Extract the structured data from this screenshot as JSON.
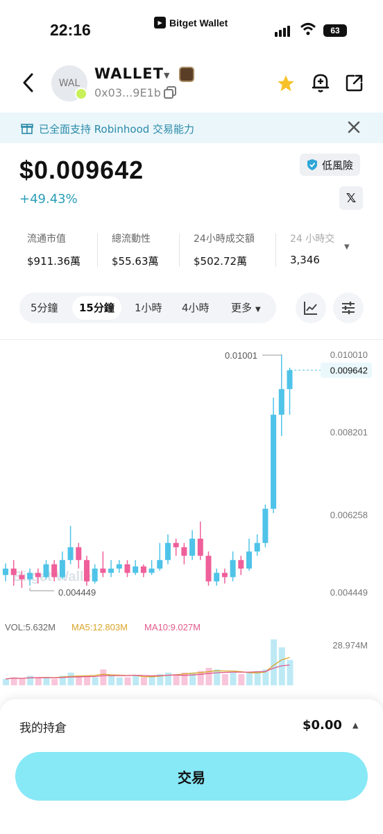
{
  "status_bar": {
    "time": "22:16",
    "brand": "Bitget Wallet",
    "battery": "63"
  },
  "header": {
    "avatar_text": "WAL",
    "token_name": "WALLET",
    "address": "0x03...9E1b"
  },
  "banner": {
    "text": "已全面支持 Robinhood 交易能力"
  },
  "price": {
    "value": "$0.009642",
    "change": "+49.43%",
    "risk": "低風險",
    "x_label": "𝕏"
  },
  "stats": [
    {
      "label": "流通市值",
      "value": "$911.36萬"
    },
    {
      "label": "總流動性",
      "value": "$55.63萬"
    },
    {
      "label": "24小時成交額",
      "value": "$502.72萬"
    },
    {
      "label": "24 小時交",
      "value": "3,346"
    }
  ],
  "timeframes": {
    "items": [
      "5分鐘",
      "15分鐘",
      "1小時",
      "4小時"
    ],
    "active": "15分鐘",
    "more": "更多"
  },
  "chart_data": {
    "type": "candlestick",
    "y_ticks": [
      "0.010010",
      "0.008201",
      "0.006258",
      "0.004449"
    ],
    "current_price": "0.009642",
    "high_label": "0.01001",
    "low_label": "0.004449",
    "watermark": "Bitget Wallet",
    "up_color": "#4fc3e8",
    "down_color": "#ef5f9a",
    "candles": [
      [
        0.00485,
        0.005,
        0.00512,
        0.0047
      ],
      [
        0.005,
        0.00485,
        0.0052,
        0.0046
      ],
      [
        0.00485,
        0.00475,
        0.00495,
        0.00455
      ],
      [
        0.00475,
        0.0049,
        0.005,
        0.0046
      ],
      [
        0.0049,
        0.0048,
        0.005,
        0.00465
      ],
      [
        0.0048,
        0.0051,
        0.0052,
        0.00475
      ],
      [
        0.0051,
        0.0048,
        0.0052,
        0.0047
      ],
      [
        0.0048,
        0.0052,
        0.0054,
        0.00475
      ],
      [
        0.0052,
        0.0055,
        0.006,
        0.0051
      ],
      [
        0.0055,
        0.0052,
        0.0056,
        0.005
      ],
      [
        0.0052,
        0.0047,
        0.0053,
        0.0046
      ],
      [
        0.0047,
        0.005,
        0.0051,
        0.00465
      ],
      [
        0.005,
        0.0049,
        0.0054,
        0.0048
      ],
      [
        0.0049,
        0.005,
        0.0052,
        0.0048
      ],
      [
        0.005,
        0.0051,
        0.0052,
        0.0049
      ],
      [
        0.0051,
        0.0049,
        0.0052,
        0.0048
      ],
      [
        0.0049,
        0.00505,
        0.0052,
        0.00485
      ],
      [
        0.00505,
        0.0049,
        0.0051,
        0.0048
      ],
      [
        0.0049,
        0.005,
        0.0052,
        0.00485
      ],
      [
        0.005,
        0.0052,
        0.0056,
        0.00495
      ],
      [
        0.0052,
        0.0056,
        0.0058,
        0.0051
      ],
      [
        0.0056,
        0.0055,
        0.0057,
        0.0053
      ],
      [
        0.0055,
        0.0053,
        0.0056,
        0.0051
      ],
      [
        0.0053,
        0.0057,
        0.0059,
        0.0052
      ],
      [
        0.0057,
        0.0053,
        0.0061,
        0.0052
      ],
      [
        0.0053,
        0.0047,
        0.0054,
        0.0046
      ],
      [
        0.0047,
        0.0049,
        0.005,
        0.0046
      ],
      [
        0.0049,
        0.0048,
        0.005,
        0.00465
      ],
      [
        0.0048,
        0.0052,
        0.0054,
        0.0047
      ],
      [
        0.0052,
        0.005,
        0.0053,
        0.00485
      ],
      [
        0.005,
        0.0054,
        0.0057,
        0.00495
      ],
      [
        0.0054,
        0.0056,
        0.0058,
        0.0053
      ],
      [
        0.0056,
        0.0064,
        0.0065,
        0.0055
      ],
      [
        0.0064,
        0.0086,
        0.009,
        0.0063
      ],
      [
        0.0086,
        0.0092,
        0.01001,
        0.0081
      ],
      [
        0.0092,
        0.00964,
        0.0097,
        0.0086
      ]
    ],
    "volume": {
      "label": "VOL:5.632M",
      "ma5_label": "MA5:12.803M",
      "ma10_label": "MA10:9.027M",
      "axis_max_label": "28.974M",
      "ma5_color": "#d9a52a",
      "ma10_color": "#e05a8a",
      "values": [
        4,
        5,
        4,
        6,
        5,
        5,
        4,
        6,
        8,
        6,
        6,
        5,
        10,
        6,
        5,
        5,
        6,
        5,
        6,
        7,
        8,
        7,
        8,
        8,
        9,
        11,
        10,
        7,
        8,
        7,
        8,
        9,
        10,
        29,
        24,
        16
      ]
    }
  },
  "holdings": {
    "label": "我的持倉",
    "value": "$0.00"
  },
  "trade_button": {
    "label": "交易"
  }
}
